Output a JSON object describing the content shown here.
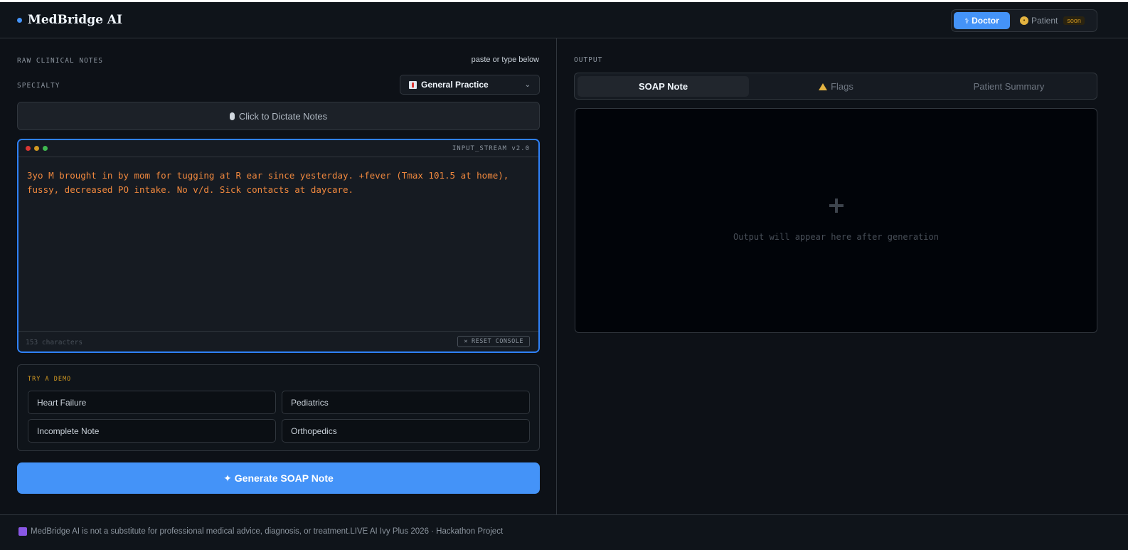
{
  "brand": {
    "name": "MedBridge AI",
    "accent": "#4493f8"
  },
  "mode_switch": {
    "doctor_label": "Doctor",
    "patient_label": "Patient",
    "soon_badge": "soon",
    "active": "Doctor"
  },
  "input_panel": {
    "label": "RAW CLINICAL NOTES",
    "hint": "paste or type below",
    "specialty_label": "SPECIALTY",
    "specialty_value": "General Practice",
    "dictate_label": "Click to Dictate Notes",
    "console_title": "INPUT_STREAM v2.0",
    "notes_text": "3yo M brought in by mom for tugging at R ear since yesterday. +fever (Tmax 101.5 at home), fussy, decreased PO intake. No v/d. Sick contacts at daycare. ",
    "char_count": "153 characters",
    "reset_label": "RESET CONSOLE"
  },
  "demo": {
    "title": "TRY A DEMO",
    "buttons": [
      "Heart Failure",
      "Pediatrics",
      "Incomplete Note",
      "Orthopedics"
    ]
  },
  "generate_label": "✦ Generate SOAP Note",
  "output_panel": {
    "label": "OUTPUT",
    "tabs": [
      "SOAP Note",
      "Flags",
      "Patient Summary"
    ],
    "active_tab": "SOAP Note",
    "empty_text": "Output will appear here after generation"
  },
  "footer": {
    "text": "MedBridge AI is not a substitute for professional medical advice, diagnosis, or treatment.LIVE AI Ivy Plus 2026 · Hackathon Project"
  }
}
